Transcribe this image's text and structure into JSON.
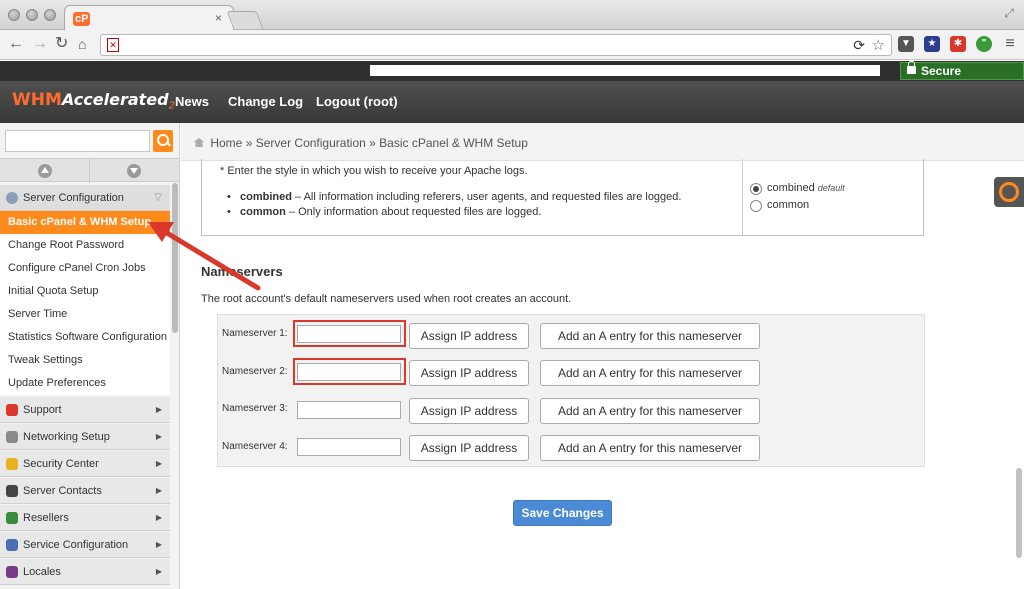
{
  "browser": {
    "tab_favicon": "cP",
    "tab_title": "",
    "tab_close": "×",
    "secure_connection": "Secure Connection"
  },
  "whm": {
    "logo_main": "WHM",
    "logo_accel": "Accelerated",
    "logo_sub": "2",
    "nav": [
      "News",
      "Change Log",
      "Logout (root)"
    ]
  },
  "sidebar": {
    "search_placeholder": "",
    "open_section": "Server Configuration",
    "sub_items": [
      "Basic cPanel & WHM Setup",
      "Change Root Password",
      "Configure cPanel Cron Jobs",
      "Initial Quota Setup",
      "Server Time",
      "Statistics Software Configuration",
      "Tweak Settings",
      "Update Preferences"
    ],
    "sections": [
      {
        "label": "Support",
        "icon_color": "#d9382a"
      },
      {
        "label": "Networking Setup",
        "icon_color": "#8a8a8a"
      },
      {
        "label": "Security Center",
        "icon_color": "#e8b21e"
      },
      {
        "label": "Server Contacts",
        "icon_color": "#444444"
      },
      {
        "label": "Resellers",
        "icon_color": "#3c8a3c"
      },
      {
        "label": "Service Configuration",
        "icon_color": "#4a6fb0"
      },
      {
        "label": "Locales",
        "icon_color": "#7a3a8a"
      }
    ]
  },
  "breadcrumb": {
    "home": "Home",
    "sep1": "»",
    "level1": "Server Configuration",
    "sep2": "»",
    "current": "Basic cPanel & WHM Setup"
  },
  "apache_logs": {
    "description": "* Enter the style in which you wish to receive your Apache logs.",
    "combined_term": "combined",
    "combined_desc": " – All information including referers, user agents, and requested files are logged.",
    "common_term": "common",
    "common_desc": " – Only information about requested files are logged.",
    "option_combined": "combined",
    "option_combined_note": "default",
    "option_common": "common",
    "selected": "combined"
  },
  "nameservers": {
    "title": "Nameservers",
    "description": "The root account's default nameservers used when root creates an account.",
    "rows": [
      {
        "label": "Nameserver 1:",
        "value": "",
        "assign": "Assign IP address",
        "add": "Add an A entry for this nameserver"
      },
      {
        "label": "Nameserver 2:",
        "value": "",
        "assign": "Assign IP address",
        "add": "Add an A entry for this nameserver"
      },
      {
        "label": "Nameserver 3:",
        "value": "",
        "assign": "Assign IP address",
        "add": "Add an A entry for this nameserver"
      },
      {
        "label": "Nameserver 4:",
        "value": "",
        "assign": "Assign IP address",
        "add": "Add an A entry for this nameserver"
      }
    ]
  },
  "save_label": "Save Changes",
  "colors": {
    "accent_orange": "#ff8a1c",
    "highlight_red": "#d9382a",
    "save_blue": "#4b8bd6"
  }
}
